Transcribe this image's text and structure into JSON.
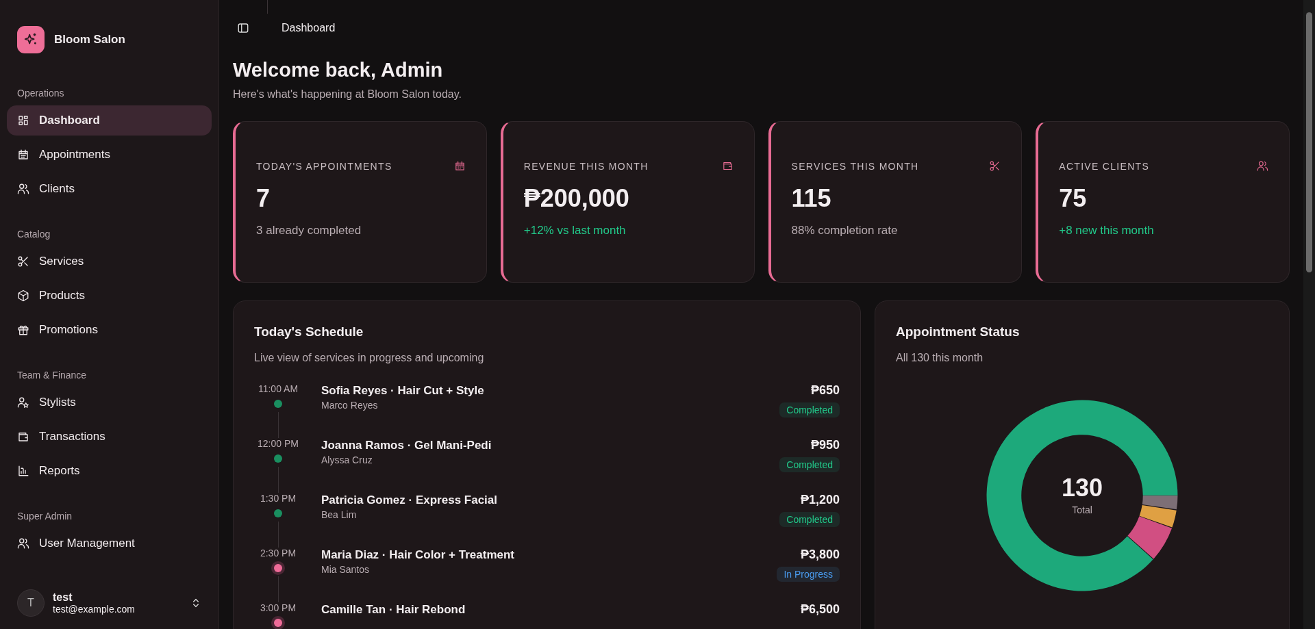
{
  "brand": {
    "name": "Bloom Salon"
  },
  "sidebar": {
    "sections": [
      {
        "label": "Operations",
        "items": [
          {
            "label": "Dashboard",
            "selected": true
          },
          {
            "label": "Appointments",
            "selected": false
          },
          {
            "label": "Clients",
            "selected": false
          }
        ]
      },
      {
        "label": "Catalog",
        "items": [
          {
            "label": "Services",
            "selected": false
          },
          {
            "label": "Products",
            "selected": false
          },
          {
            "label": "Promotions",
            "selected": false
          }
        ]
      },
      {
        "label": "Team & Finance",
        "items": [
          {
            "label": "Stylists",
            "selected": false
          },
          {
            "label": "Transactions",
            "selected": false
          },
          {
            "label": "Reports",
            "selected": false
          }
        ]
      },
      {
        "label": "Super Admin",
        "items": [
          {
            "label": "User Management",
            "selected": false
          }
        ]
      }
    ]
  },
  "user": {
    "initial": "T",
    "name": "test",
    "email": "test@example.com"
  },
  "header": {
    "breadcrumb": "Dashboard"
  },
  "page": {
    "title": "Welcome back, Admin",
    "subtitle": "Here's what's happening at Bloom Salon today."
  },
  "stats": [
    {
      "label": "TODAY'S APPOINTMENTS",
      "value": "7",
      "note": "3 already completed",
      "positive": false
    },
    {
      "label": "REVENUE THIS MONTH",
      "value": "₱200,000",
      "note": "+12% vs last month",
      "positive": true
    },
    {
      "label": "SERVICES THIS MONTH",
      "value": "115",
      "note": "88% completion rate",
      "positive": false
    },
    {
      "label": "ACTIVE CLIENTS",
      "value": "75",
      "note": "+8 new this month",
      "positive": true
    }
  ],
  "schedule": {
    "title": "Today's Schedule",
    "subtitle": "Live view of services in progress and upcoming",
    "items": [
      {
        "time": "11:00 AM",
        "title": "Sofia Reyes · Hair Cut + Style",
        "stylist": "Marco Reyes",
        "price": "₱650",
        "status": "Completed",
        "kind": "completed"
      },
      {
        "time": "12:00 PM",
        "title": "Joanna Ramos · Gel Mani-Pedi",
        "stylist": "Alyssa Cruz",
        "price": "₱950",
        "status": "Completed",
        "kind": "completed"
      },
      {
        "time": "1:30 PM",
        "title": "Patricia Gomez · Express Facial",
        "stylist": "Bea Lim",
        "price": "₱1,200",
        "status": "Completed",
        "kind": "completed"
      },
      {
        "time": "2:30 PM",
        "title": "Maria Diaz · Hair Color + Treatment",
        "stylist": "Mia Santos",
        "price": "₱3,800",
        "status": "In Progress",
        "kind": "in_progress"
      },
      {
        "time": "3:00 PM",
        "title": "Camille Tan · Hair Rebond",
        "price": "₱6,500",
        "kind": "in_progress"
      }
    ]
  },
  "status_card": {
    "title": "Appointment Status",
    "subtitle": "All 130 this month",
    "total": "130",
    "total_label": "Total"
  }
}
